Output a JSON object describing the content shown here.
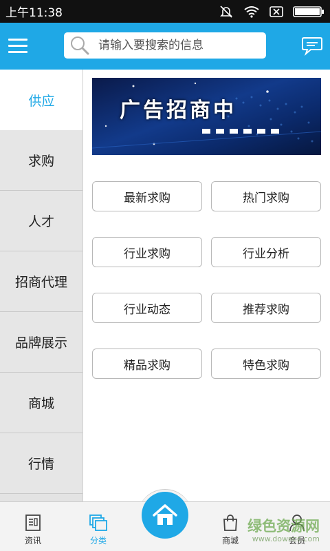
{
  "status_bar": {
    "time": "上午11:38"
  },
  "search": {
    "placeholder": "请输入要搜索的信息"
  },
  "sidebar": {
    "items": [
      {
        "label": "供应",
        "active": true
      },
      {
        "label": "求购"
      },
      {
        "label": "人才"
      },
      {
        "label": "招商代理"
      },
      {
        "label": "品牌展示"
      },
      {
        "label": "商城"
      },
      {
        "label": "行情"
      }
    ]
  },
  "banner": {
    "text": "广告招商中"
  },
  "grid": {
    "buttons": [
      "最新求购",
      "热门求购",
      "行业求购",
      "行业分析",
      "行业动态",
      "推荐求购",
      "精品求购",
      "特色求购"
    ]
  },
  "bottom_nav": {
    "items": [
      {
        "label": "资讯",
        "icon": "news-icon"
      },
      {
        "label": "分类",
        "icon": "category-icon",
        "active": true
      },
      {
        "label": "",
        "icon": "home-icon"
      },
      {
        "label": "商城",
        "icon": "shopping-bag-icon"
      },
      {
        "label": "会员",
        "icon": "member-icon"
      }
    ]
  },
  "watermark": {
    "text": "绿色资源网",
    "sub": "www.downcc.com"
  },
  "colors": {
    "accent": "#1fa8e6",
    "sidebar_bg": "#e3e3e3"
  }
}
